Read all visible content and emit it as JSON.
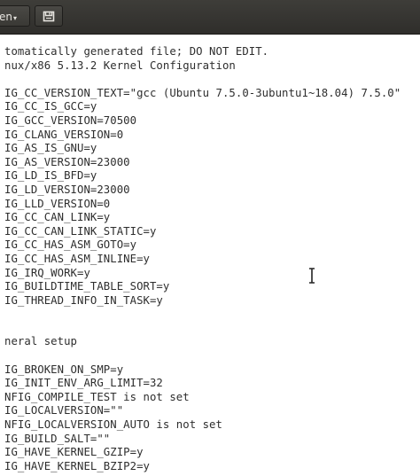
{
  "toolbar": {
    "open_label": "en",
    "open_caret": "▾",
    "icon": "save-to-disk-icon"
  },
  "editor": {
    "lines": [
      "tomatically generated file; DO NOT EDIT.",
      "nux/x86 5.13.2 Kernel Configuration",
      "",
      "IG_CC_VERSION_TEXT=\"gcc (Ubuntu 7.5.0-3ubuntu1~18.04) 7.5.0\"",
      "IG_CC_IS_GCC=y",
      "IG_GCC_VERSION=70500",
      "IG_CLANG_VERSION=0",
      "IG_AS_IS_GNU=y",
      "IG_AS_VERSION=23000",
      "IG_LD_IS_BFD=y",
      "IG_LD_VERSION=23000",
      "IG_LLD_VERSION=0",
      "IG_CC_CAN_LINK=y",
      "IG_CC_CAN_LINK_STATIC=y",
      "IG_CC_HAS_ASM_GOTO=y",
      "IG_CC_HAS_ASM_INLINE=y",
      "IG_IRQ_WORK=y",
      "IG_BUILDTIME_TABLE_SORT=y",
      "IG_THREAD_INFO_IN_TASK=y",
      "",
      "",
      "neral setup",
      "",
      "IG_BROKEN_ON_SMP=y",
      "IG_INIT_ENV_ARG_LIMIT=32",
      "NFIG_COMPILE_TEST is not set",
      "IG_LOCALVERSION=\"\"",
      "NFIG_LOCALVERSION_AUTO is not set",
      "IG_BUILD_SALT=\"\"",
      "IG_HAVE_KERNEL_GZIP=y",
      "IG_HAVE_KERNEL_BZIP2=y"
    ]
  }
}
